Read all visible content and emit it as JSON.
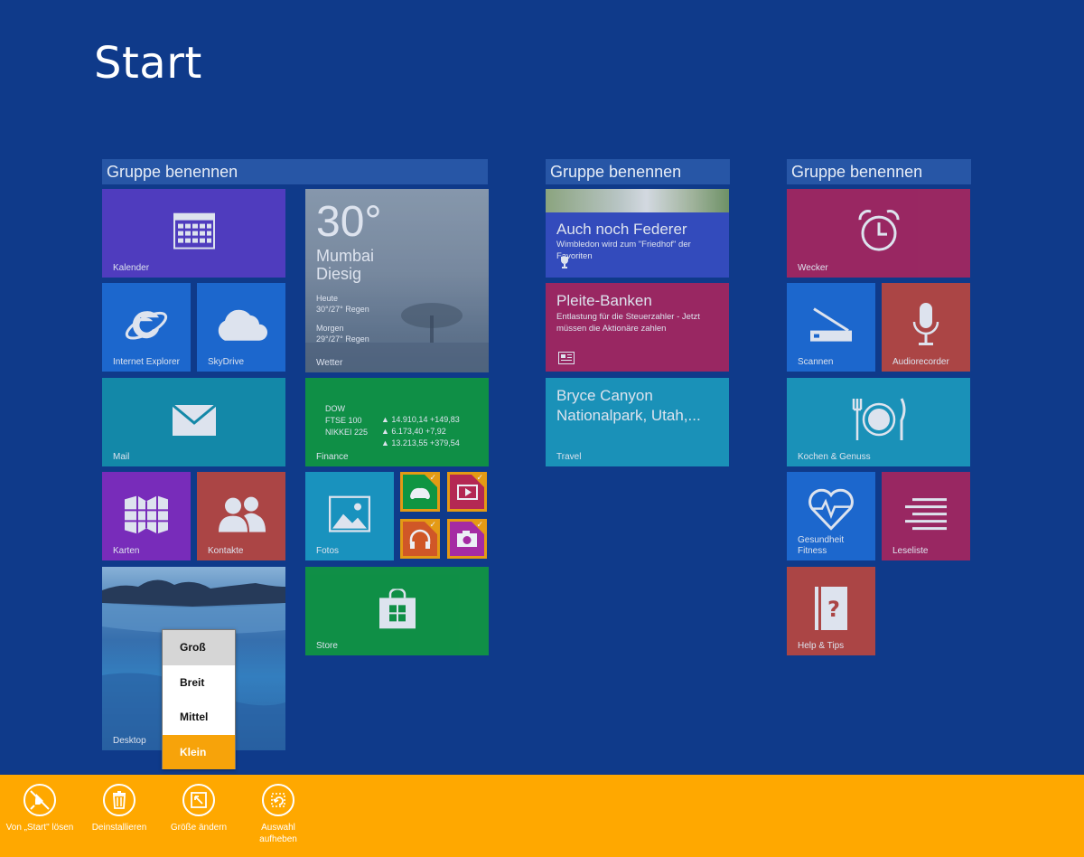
{
  "page_title": "Start",
  "groups": [
    {
      "name": "Gruppe benennen"
    },
    {
      "name": "Gruppe benennen"
    },
    {
      "name": "Gruppe benennen"
    }
  ],
  "tiles": {
    "kalender": "Kalender",
    "ie": "Internet Explorer",
    "skydrive": "SkyDrive",
    "mail": "Mail",
    "karten": "Karten",
    "kontakte": "Kontakte",
    "desktop": "Desktop",
    "weather": {
      "temp": "30°",
      "city": "Mumbai",
      "condition": "Diesig",
      "today_label": "Heute",
      "today_value": "30°/27° Regen",
      "tomorrow_label": "Morgen",
      "tomorrow_value": "29°/27° Regen",
      "label": "Wetter"
    },
    "finance": {
      "rows": [
        {
          "name": "DOW",
          "value": "▲ 14.910,14 +149,83"
        },
        {
          "name": "FTSE 100",
          "value": "▲ 6.173,40 +7,92"
        },
        {
          "name": "NIKKEI 225",
          "value": "▲ 13.213,55 +379,54"
        }
      ],
      "label": "Finance"
    },
    "fotos": "Fotos",
    "store": "Store",
    "news1": {
      "title": "Auch noch Federer",
      "sub": "Wimbledon wird zum \"Friedhof\" der Favoriten"
    },
    "news2": {
      "title": "Pleite-Banken",
      "sub": "Entlastung für die Steuerzahler - Jetzt müssen die Aktionäre zahlen"
    },
    "travel": {
      "title_line1": "Bryce Canyon",
      "title_line2": "Nationalpark, Utah,...",
      "label": "Travel"
    },
    "wecker": "Wecker",
    "scannen": "Scannen",
    "audiorecorder": "Audiorecorder",
    "kochen": "Kochen & Genuss",
    "gesundheit_line1": "Gesundheit",
    "gesundheit_line2": "Fitness",
    "leseliste": "Leseliste",
    "help": "Help & Tips"
  },
  "size_menu": {
    "items": [
      "Groß",
      "Breit",
      "Mittel",
      "Klein"
    ],
    "hover": "Groß",
    "selected": "Klein"
  },
  "appbar": {
    "unpin": "Von „Start\" lösen",
    "uninstall": "Deinstallieren",
    "resize": "Größe ändern",
    "clear_line1": "Auswahl",
    "clear_line2": "aufheben"
  },
  "colors": {
    "background": "#0f3a8a",
    "appbar": "#ffa800",
    "selection": "#f7a30a"
  }
}
